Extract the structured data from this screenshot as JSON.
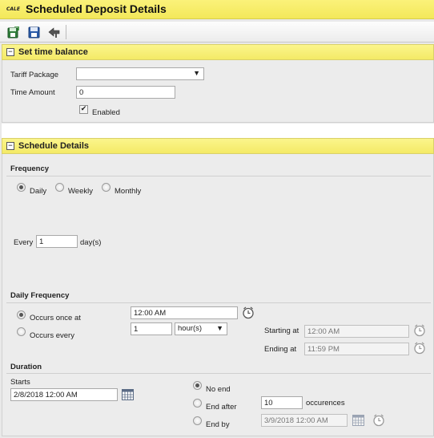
{
  "window": {
    "logo_text": "CALE",
    "title": "Scheduled Deposit Details"
  },
  "toolbar": {
    "icons": [
      "save-and-new-icon",
      "save-icon",
      "back-icon"
    ]
  },
  "time_balance": {
    "header": "Set time balance",
    "toggle": "−",
    "tariff_label": "Tariff Package",
    "tariff_value": "",
    "time_amount_label": "Time Amount",
    "time_amount_value": "0",
    "enabled_label": "Enabled",
    "enabled_checked": true
  },
  "schedule": {
    "header": "Schedule Details",
    "toggle": "−",
    "frequency_label": "Frequency",
    "frequency_options": [
      "Daily",
      "Weekly",
      "Monthly"
    ],
    "frequency_selected": "Daily",
    "every_label": "Every",
    "every_value": "1",
    "every_unit": "day(s)",
    "daily_frequency_label": "Daily Frequency",
    "occurs_once_label": "Occurs once at",
    "occurs_once_value": "12:00 AM",
    "occurs_every_label": "Occurs every",
    "occurs_every_value": "1",
    "occurs_every_unit": "hour(s)",
    "starting_at_label": "Starting at",
    "starting_at_value": "12:00 AM",
    "ending_at_label": "Ending at",
    "ending_at_value": "11:59 PM",
    "duration_label": "Duration",
    "starts_label": "Starts",
    "starts_value": "2/8/2018 12:00 AM",
    "no_end_label": "No end",
    "end_after_label": "End after",
    "end_after_value": "10",
    "occurrences_label": "occurences",
    "end_by_label": "End by",
    "end_by_value": "3/9/2018 12:00 AM"
  }
}
